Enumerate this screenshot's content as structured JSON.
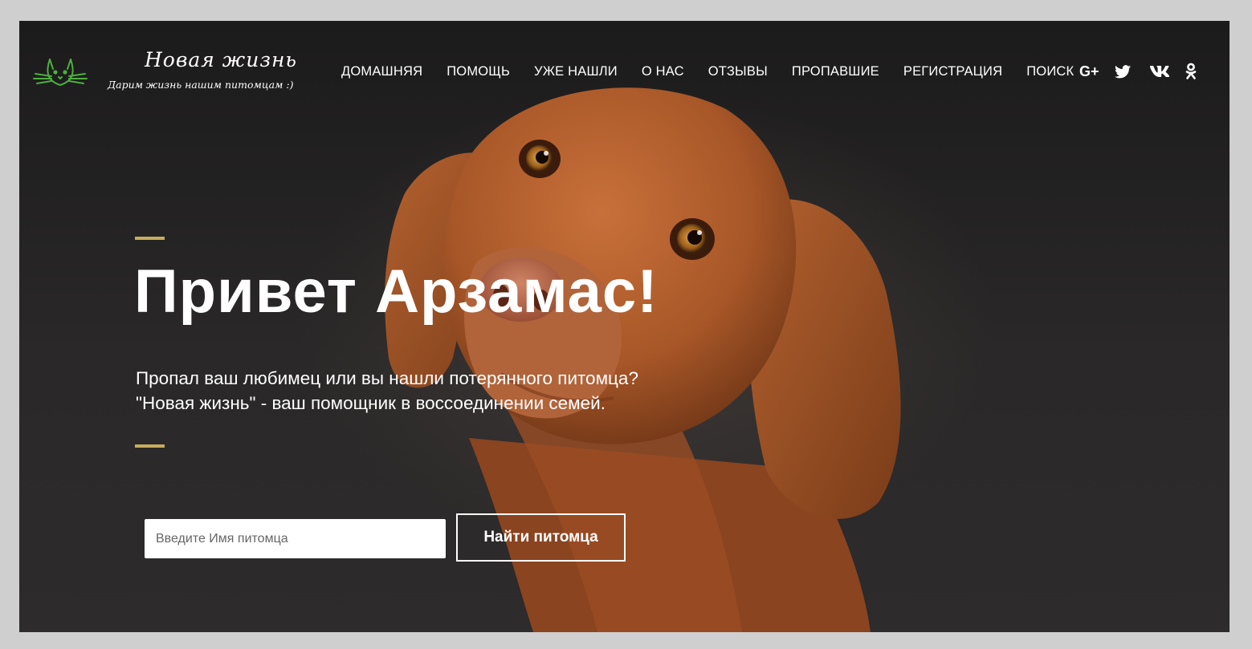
{
  "logo": {
    "title": "Новая жизнь",
    "subtitle": "Дарим жизнь нашим питомцам :)",
    "icon": "cat-icon",
    "icon_color": "#4caf3f"
  },
  "nav": {
    "items": [
      {
        "label": "ДОМАШНЯЯ"
      },
      {
        "label": "ПОМОЩЬ"
      },
      {
        "label": "УЖЕ НАШЛИ"
      },
      {
        "label": "О НАС"
      },
      {
        "label": "ОТЗЫВЫ"
      },
      {
        "label": "ПРОПАВШИЕ"
      },
      {
        "label": "РЕГИСТРАЦИЯ"
      },
      {
        "label": "ПОИСК"
      }
    ]
  },
  "social": {
    "gplus": {
      "label": "G+",
      "icon": "google-plus-icon"
    },
    "twitter": {
      "icon": "twitter-icon"
    },
    "vk": {
      "icon": "vk-icon"
    },
    "ok": {
      "icon": "odnoklassniki-icon"
    }
  },
  "hero": {
    "title": "Привет Арзамас!",
    "line1": "Пропал ваш любимец или вы нашли потерянного питомца?",
    "line2": "\"Новая жизнь\" - ваш помощник в воссоединении семей.",
    "accent_color": "#c7ac5e",
    "background_image": "dog-photo"
  },
  "search": {
    "placeholder": "Введите Имя питомца",
    "value": "",
    "button_label": "Найти питомца"
  }
}
